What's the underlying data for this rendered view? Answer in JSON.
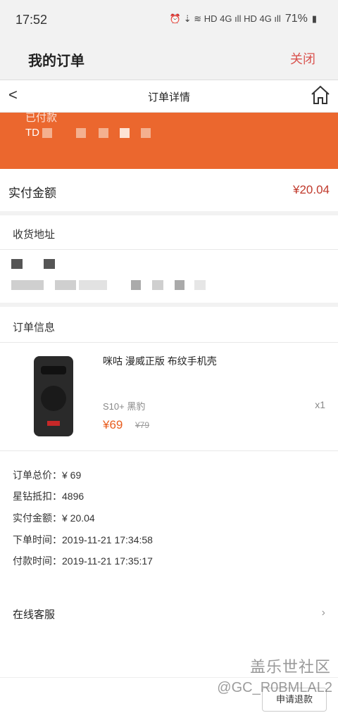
{
  "status_bar": {
    "time": "17:52",
    "icons": "⏰ ⇣ ≋ HD 4G ıll HD 4G ıll",
    "battery": "71%"
  },
  "app": {
    "title": "我的订单",
    "close_label": "关闭"
  },
  "nav": {
    "back_label": "<",
    "title": "订单详情"
  },
  "banner": {
    "status_partial": "已付款",
    "code_prefix": "TD"
  },
  "paid": {
    "label": "实付金额",
    "value": "¥20.04"
  },
  "address": {
    "section_label": "收货地址"
  },
  "order_info": {
    "section_label": "订单信息"
  },
  "product": {
    "name": "咪咕 漫威正版 布纹手机壳",
    "spec": "S10+ 黑豹",
    "qty": "x1",
    "price": "¥69",
    "original_price": "¥79"
  },
  "details": [
    "订单总价：¥ 69",
    "星钻抵扣：4896",
    "实付金额：¥ 20.04",
    "下单时间：2019-11-21 17:34:58",
    "付款时间：2019-11-21 17:35:17"
  ],
  "service": {
    "label": "在线客服",
    "chevron": "›"
  },
  "footer": {
    "refund_label": "申请退款"
  },
  "watermark": {
    "line1": "盖乐世社区",
    "line2": "@GC_R0BMLAL2"
  },
  "colors": {
    "accent_orange": "#eb672e",
    "price_red": "#c0392b",
    "close_red": "#d9534f"
  }
}
